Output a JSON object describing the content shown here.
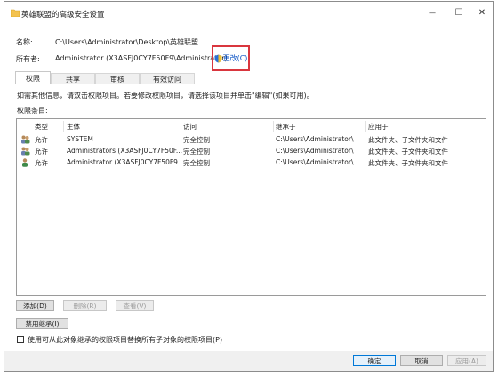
{
  "window": {
    "title": "英雄联盟的高级安全设置",
    "minimize_glyph": "—",
    "maximize_glyph": "☐",
    "close_glyph": "✕"
  },
  "info": {
    "name_label": "名称:",
    "name_value": "C:\\Users\\Administrator\\Desktop\\英雄联盟",
    "owner_label": "所有者:",
    "owner_value": "Administrator (X3ASFJ0CY7F50F9\\Administrator)",
    "change_label": "更改(C)"
  },
  "tabs": [
    {
      "label": "权限",
      "active": true
    },
    {
      "label": "共享",
      "active": false
    },
    {
      "label": "审核",
      "active": false
    },
    {
      "label": "有效访问",
      "active": false
    }
  ],
  "description": "如需其他信息，请双击权限项目。若要修改权限项目，请选择该项目并单击\"编辑\"(如果可用)。",
  "entries_label": "权限条目:",
  "table": {
    "headers": [
      "类型",
      "主体",
      "访问",
      "继承于",
      "应用于"
    ],
    "rows": [
      {
        "icon": "users-group-icon",
        "type": "允许",
        "principal": "SYSTEM",
        "access": "完全控制",
        "inherited": "C:\\Users\\Administrator\\",
        "applies": "此文件夹、子文件夹和文件"
      },
      {
        "icon": "users-group-icon",
        "type": "允许",
        "principal": "Administrators (X3ASFJ0CY7F50F...",
        "access": "完全控制",
        "inherited": "C:\\Users\\Administrator\\",
        "applies": "此文件夹、子文件夹和文件"
      },
      {
        "icon": "user-icon",
        "type": "允许",
        "principal": "Administrator (X3ASFJ0CY7F50F9...",
        "access": "完全控制",
        "inherited": "C:\\Users\\Administrator\\",
        "applies": "此文件夹、子文件夹和文件"
      }
    ]
  },
  "buttons": {
    "add": "添加(D)",
    "remove": "删除(R)",
    "view": "查看(V)",
    "disable_inheritance": "禁用继承(I)",
    "ok": "确定",
    "cancel": "取消",
    "apply": "应用(A)"
  },
  "replace_checkbox_label": "使用可从此对象继承的权限项目替换所有子对象的权限项目(P)",
  "colors": {
    "highlight_border": "#d9363e",
    "link": "#0a52c4",
    "primary_button_border": "#0078d7"
  }
}
